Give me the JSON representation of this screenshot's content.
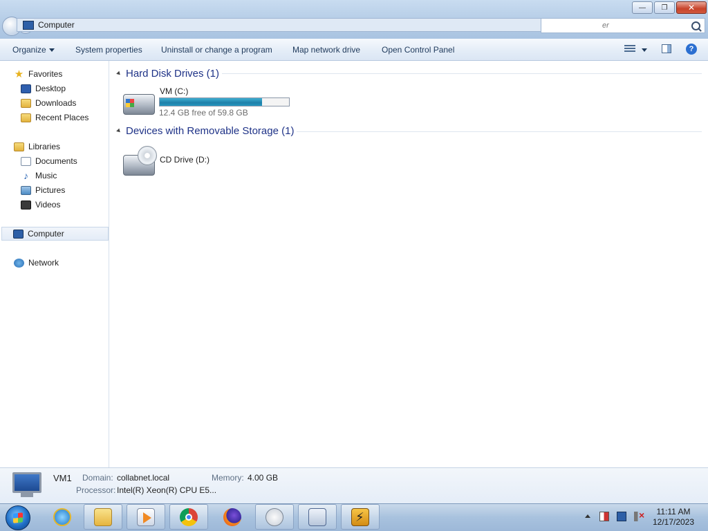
{
  "window": {
    "address": "Computer",
    "search_placeholder": "er",
    "buttons": {
      "minimize": "—",
      "maximize": "❐",
      "close": "✕"
    }
  },
  "toolbar": {
    "organize": "Organize",
    "system_properties": "System properties",
    "uninstall": "Uninstall or change a program",
    "map_drive": "Map network drive",
    "control_panel": "Open Control Panel",
    "help": "?"
  },
  "nav": {
    "favorites": "Favorites",
    "desktop": "Desktop",
    "downloads": "Downloads",
    "recent": "Recent Places",
    "libraries": "Libraries",
    "documents": "Documents",
    "music": "Music",
    "pictures": "Pictures",
    "videos": "Videos",
    "computer": "Computer",
    "network": "Network"
  },
  "groups": {
    "hdd": {
      "title": "Hard Disk Drives (1)"
    },
    "removable": {
      "title": "Devices with Removable Storage (1)"
    }
  },
  "drives": {
    "c": {
      "name": "VM (C:)",
      "free": "12.4 GB free of 59.8 GB",
      "used_fraction": 0.79
    },
    "d": {
      "name": "CD Drive (D:)"
    }
  },
  "details": {
    "name": "VM1",
    "domain_label": "Domain:",
    "domain": "collabnet.local",
    "memory_label": "Memory:",
    "memory": "4.00 GB",
    "processor_label": "Processor:",
    "processor": "Intel(R) Xeon(R) CPU E5..."
  },
  "taskbar": {
    "time": "11:11 AM",
    "date": "12/17/2023"
  }
}
